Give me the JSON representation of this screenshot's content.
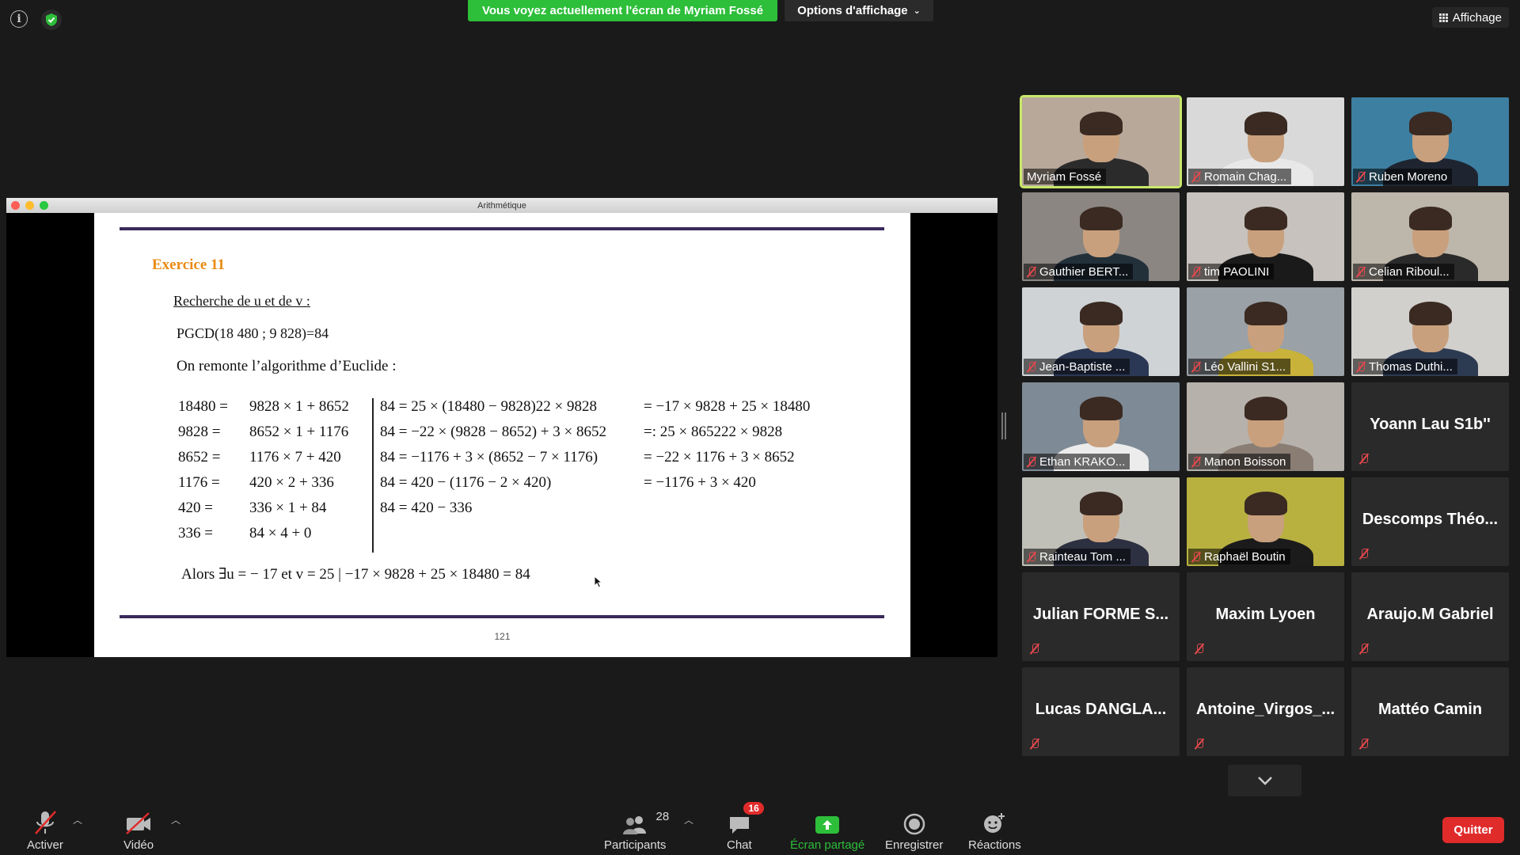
{
  "top": {
    "share_banner": "Vous voyez actuellement l'écran de Myriam Fossé",
    "view_options": "Options d'affichage",
    "affichage": "Affichage"
  },
  "shared_window": {
    "title": "Arithmétique",
    "exercise_title": "Exercice 11",
    "subtitle": "Recherche de u et de v :",
    "pgcd": "PGCD(18 480 ; 9 828)=84",
    "intro": "On remonte l’algorithme d’Euclide :",
    "rows": [
      {
        "a": "18480 =",
        "b": "9828 × 1 + 8652",
        "c": "84 = 25 × (18480 − 9828)22 × 9828",
        "d": "= −17 × 9828 + 25 × 18480"
      },
      {
        "a": "9828 =",
        "b": "8652 × 1 + 1176",
        "c": "84 = −22 × (9828 − 8652) + 3 × 8652",
        "d": "=: 25 × 865222 × 9828"
      },
      {
        "a": "8652 =",
        "b": "1176 × 7 + 420",
        "c": "84 = −1176 + 3 × (8652 − 7 × 1176)",
        "d": "= −22 × 1176 + 3 × 8652"
      },
      {
        "a": "1176 =",
        "b": "420 × 2 + 336",
        "c": "84 = 420 − (1176 − 2 × 420)",
        "d": "= −1176 + 3 × 420"
      },
      {
        "a": "420 =",
        "b": "336 × 1 + 84",
        "c": "84 = 420 − 336",
        "d": ""
      },
      {
        "a": "336 =",
        "b": "84 × 4 + 0",
        "c": "",
        "d": ""
      }
    ],
    "conclusion": "Alors ∃u = − 17 et v = 25    |  −17 × 9828 + 25 × 18480 = 84",
    "page_number": "121"
  },
  "gallery": [
    {
      "name": "Myriam Fossé",
      "video": true,
      "muted": false,
      "active": true,
      "bg": "#b8a89a",
      "shirt": "#2b2b2b"
    },
    {
      "name": "Romain Chag...",
      "video": true,
      "muted": true,
      "bg": "#d9d9d9",
      "shirt": "#e8e8e8"
    },
    {
      "name": "Ruben Moreno",
      "video": true,
      "muted": true,
      "bg": "#3d7fa1",
      "shirt": "#1e2530"
    },
    {
      "name": "Gauthier BERT...",
      "video": true,
      "muted": true,
      "bg": "#8b8682",
      "shirt": "#22303a"
    },
    {
      "name": "tim PAOLINI",
      "video": true,
      "muted": true,
      "bg": "#c7c2bd",
      "shirt": "#1a1a1a"
    },
    {
      "name": "Celian Riboul...",
      "video": true,
      "muted": true,
      "bg": "#bdb6aa",
      "shirt": "#2a2a2a"
    },
    {
      "name": "Jean-Baptiste ...",
      "video": true,
      "muted": true,
      "bg": "#cfd3d6",
      "shirt": "#2a3855"
    },
    {
      "name": "Léo Vallini S1...",
      "video": true,
      "muted": true,
      "bg": "#9aa1a7",
      "shirt": "#c8b23a"
    },
    {
      "name": "Thomas Duthi...",
      "video": true,
      "muted": true,
      "bg": "#d2d0cc",
      "shirt": "#2d3b52"
    },
    {
      "name": "Ethan KRAKO...",
      "video": true,
      "muted": true,
      "bg": "#7e8a95",
      "shirt": "#ececec"
    },
    {
      "name": "Manon Boisson",
      "video": true,
      "muted": true,
      "bg": "#b7b1ac",
      "shirt": "#8a7d74"
    },
    {
      "name": "Yoann Lau S1b''",
      "video": false,
      "muted": true
    },
    {
      "name": "Rainteau Tom ...",
      "video": true,
      "muted": true,
      "bg": "#c1c0b8",
      "shirt": "#2c3040"
    },
    {
      "name": "Raphaël Boutin",
      "video": true,
      "muted": true,
      "bg": "#b8b140",
      "shirt": "#1b1b1b"
    },
    {
      "name": "Descomps  Théo...",
      "video": false,
      "muted": true
    },
    {
      "name": "Julian  FORME S...",
      "video": false,
      "muted": true
    },
    {
      "name": "Maxim Lyoen",
      "video": false,
      "muted": true
    },
    {
      "name": "Araujo.M Gabriel",
      "video": false,
      "muted": true
    },
    {
      "name": "Lucas  DANGLA...",
      "video": false,
      "muted": true
    },
    {
      "name": "Antoine_Virgos_...",
      "video": false,
      "muted": true
    },
    {
      "name": "Mattéo Camin",
      "video": false,
      "muted": true
    }
  ],
  "toolbar": {
    "activer": "Activer",
    "video": "Vidéo",
    "participants": "Participants",
    "participants_count": "28",
    "chat": "Chat",
    "chat_badge": "16",
    "ecran_partage": "Écran partagé",
    "enregistrer": "Enregistrer",
    "reactions": "Réactions",
    "quitter": "Quitter"
  }
}
